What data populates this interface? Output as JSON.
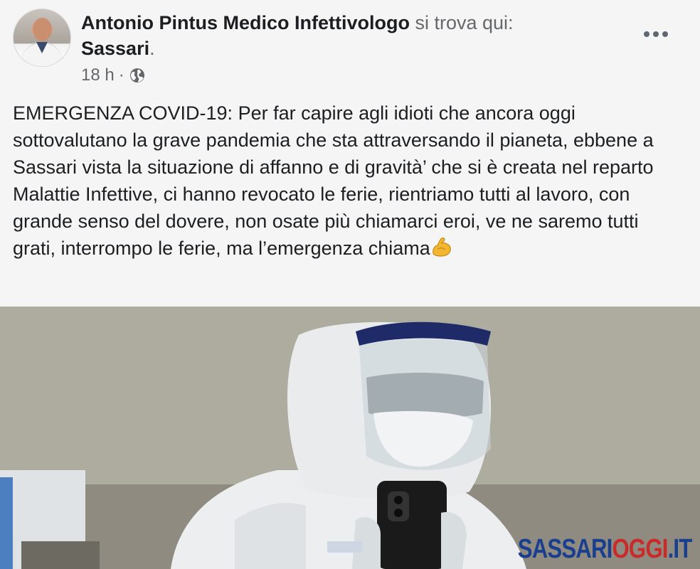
{
  "post": {
    "author": "Antonio Pintus Medico Infettivologo",
    "location_prefix": "si trova qui:",
    "location": "Sassari",
    "location_suffix": ".",
    "time": "18 h",
    "separator": "·",
    "privacy_icon": "globe-icon",
    "more_icon": "more-options-icon",
    "text": "EMERGENZA COVID-19: Per far capire agli idioti che ancora oggi sottovalutano la grave pandemia che sta attraversando il pianeta, ebbene a Sassari vista la situazione di affanno e di gravità’ che si è creata nel reparto Malattie Infettive, ci hanno revocato le ferie, rientriamo tutti al lavoro, con grande senso del dovere, non osate più chiamarci eroi, ve ne saremo tutti grati, interrompo le ferie, ma l’emergenza chiama",
    "emoji_icon": "flexed-biceps-icon"
  },
  "watermark": {
    "part1": "SASSARI",
    "part2": "OGGI",
    "part3": ".IT",
    "color_primary": "#1a3f8f",
    "color_accent": "#c92b2b"
  }
}
